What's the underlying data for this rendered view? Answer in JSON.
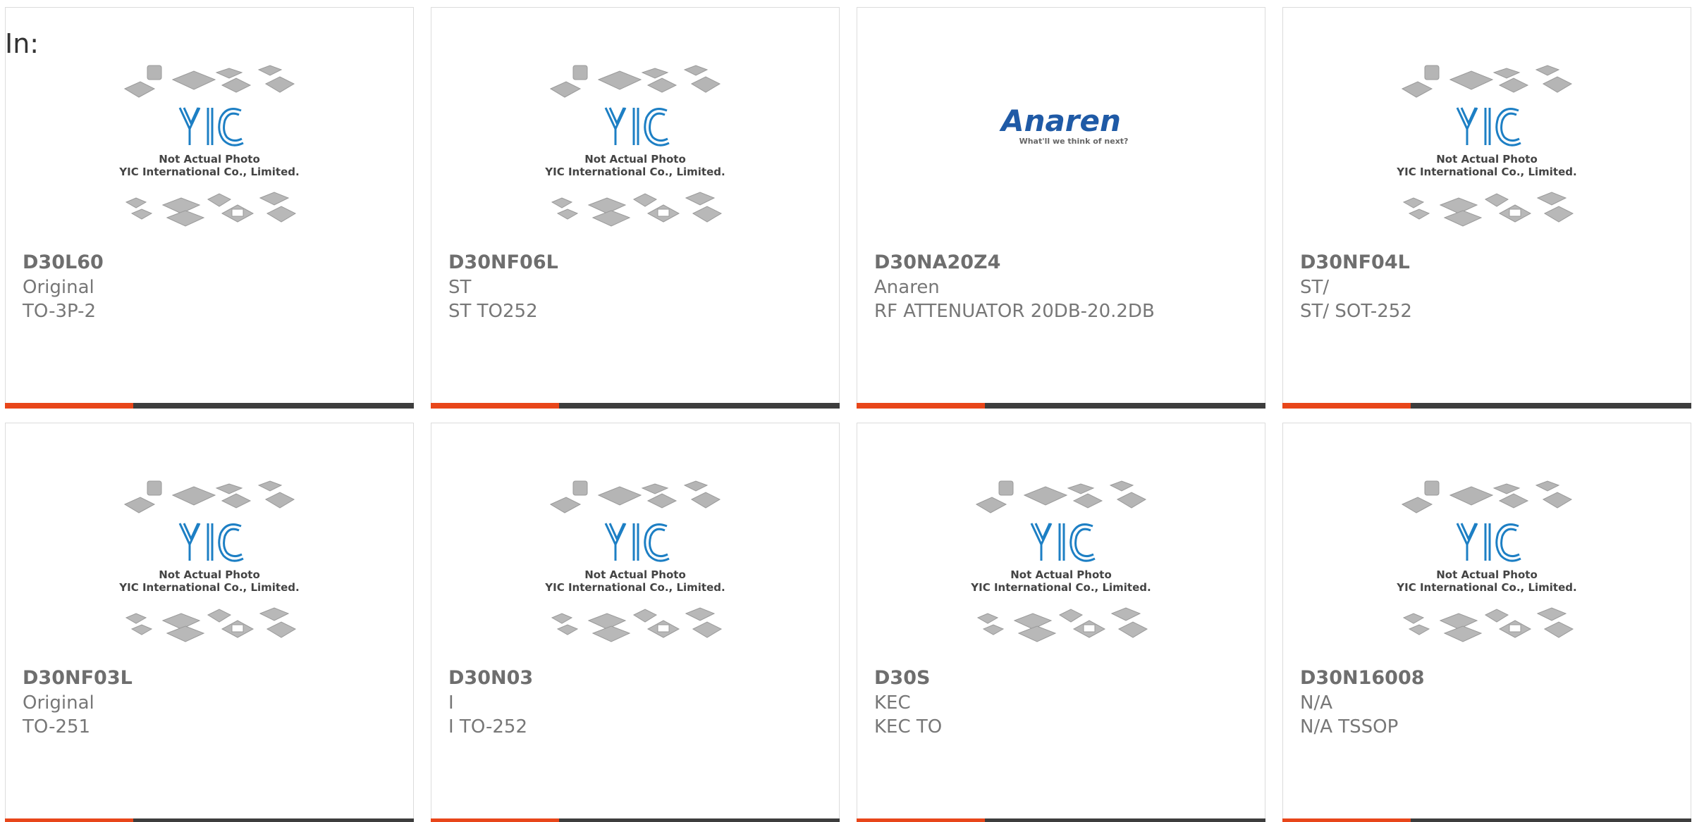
{
  "filter_label": "In:",
  "placeholder_image": {
    "line1": "Not Actual Photo",
    "line2": "YIC International Co., Limited.",
    "logo_text": "YIC"
  },
  "anaren_logo": {
    "name": "Anaren",
    "tagline": "What'll we think of next?"
  },
  "colors": {
    "accent": "#e8461a",
    "bar": "#3d3d3d",
    "yic_blue": "#1d7fc4",
    "anaren_blue": "#1f5aa6"
  },
  "products": [
    {
      "part": "D30L60",
      "manufacturer": "Original",
      "description": "TO-3P-2",
      "image": "placeholder"
    },
    {
      "part": "D30NF06L",
      "manufacturer": "ST",
      "description": "ST TO252",
      "image": "placeholder"
    },
    {
      "part": "D30NA20Z4",
      "manufacturer": "Anaren",
      "description": "RF ATTENUATOR 20DB-20.2DB",
      "image": "anaren-logo"
    },
    {
      "part": "D30NF04L",
      "manufacturer": "ST/",
      "description": "ST/ SOT-252",
      "image": "placeholder"
    },
    {
      "part": "D30NF03L",
      "manufacturer": "Original",
      "description": "TO-251",
      "image": "placeholder"
    },
    {
      "part": "D30N03",
      "manufacturer": "I",
      "description": "I TO-252",
      "image": "placeholder"
    },
    {
      "part": "D30S",
      "manufacturer": "KEC",
      "description": "KEC TO",
      "image": "placeholder"
    },
    {
      "part": "D30N16008",
      "manufacturer": "N/A",
      "description": "N/A TSSOP",
      "image": "placeholder"
    }
  ]
}
